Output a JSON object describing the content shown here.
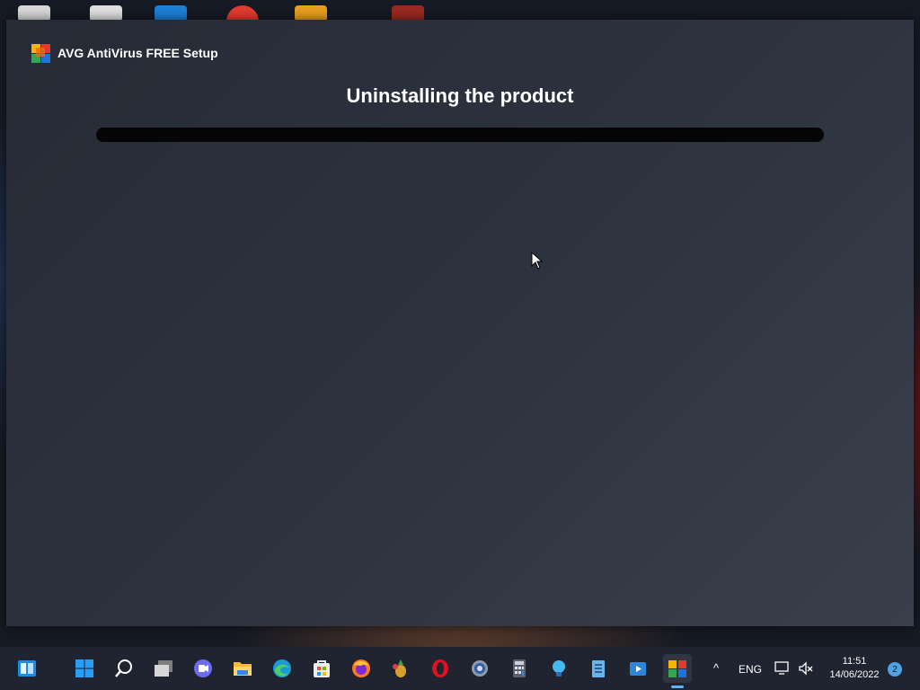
{
  "window": {
    "app_title": "AVG AntiVirus FREE Setup",
    "heading": "Uninstalling the product",
    "progress_fraction": 0
  },
  "taskbar": {
    "apps": [
      {
        "name": "show-desktop-icon",
        "color": "#2a8de4"
      },
      {
        "name": "start-icon",
        "color": "#2a8de4"
      },
      {
        "name": "search-icon",
        "color": "#ffffff"
      },
      {
        "name": "task-view-icon",
        "color": "#c8c8c8"
      },
      {
        "name": "chat-icon",
        "color": "#6e6ef0"
      },
      {
        "name": "file-explorer-icon",
        "color": "#f5c33b"
      },
      {
        "name": "edge-icon",
        "color": "#1ea7e0"
      },
      {
        "name": "store-icon",
        "color": "#e8e8e8"
      },
      {
        "name": "firefox-icon",
        "color": "#ff7a1a"
      },
      {
        "name": "pineapple-app-icon",
        "color": "#c9a23b"
      },
      {
        "name": "opera-icon",
        "color": "#e01020"
      },
      {
        "name": "settings-icon",
        "color": "#9aa4b0"
      },
      {
        "name": "calculator-icon",
        "color": "#c8c8c8"
      },
      {
        "name": "tips-icon",
        "color": "#4ab8f0"
      },
      {
        "name": "notepad-icon",
        "color": "#68b0e8"
      },
      {
        "name": "media-player-icon",
        "color": "#2f86d9"
      },
      {
        "name": "avg-taskbar-icon",
        "color": "#e04a2a"
      }
    ],
    "tray": {
      "chevron": "^",
      "language": "ENG",
      "time": "11:51",
      "date": "14/06/2022",
      "notifications": "2"
    }
  }
}
